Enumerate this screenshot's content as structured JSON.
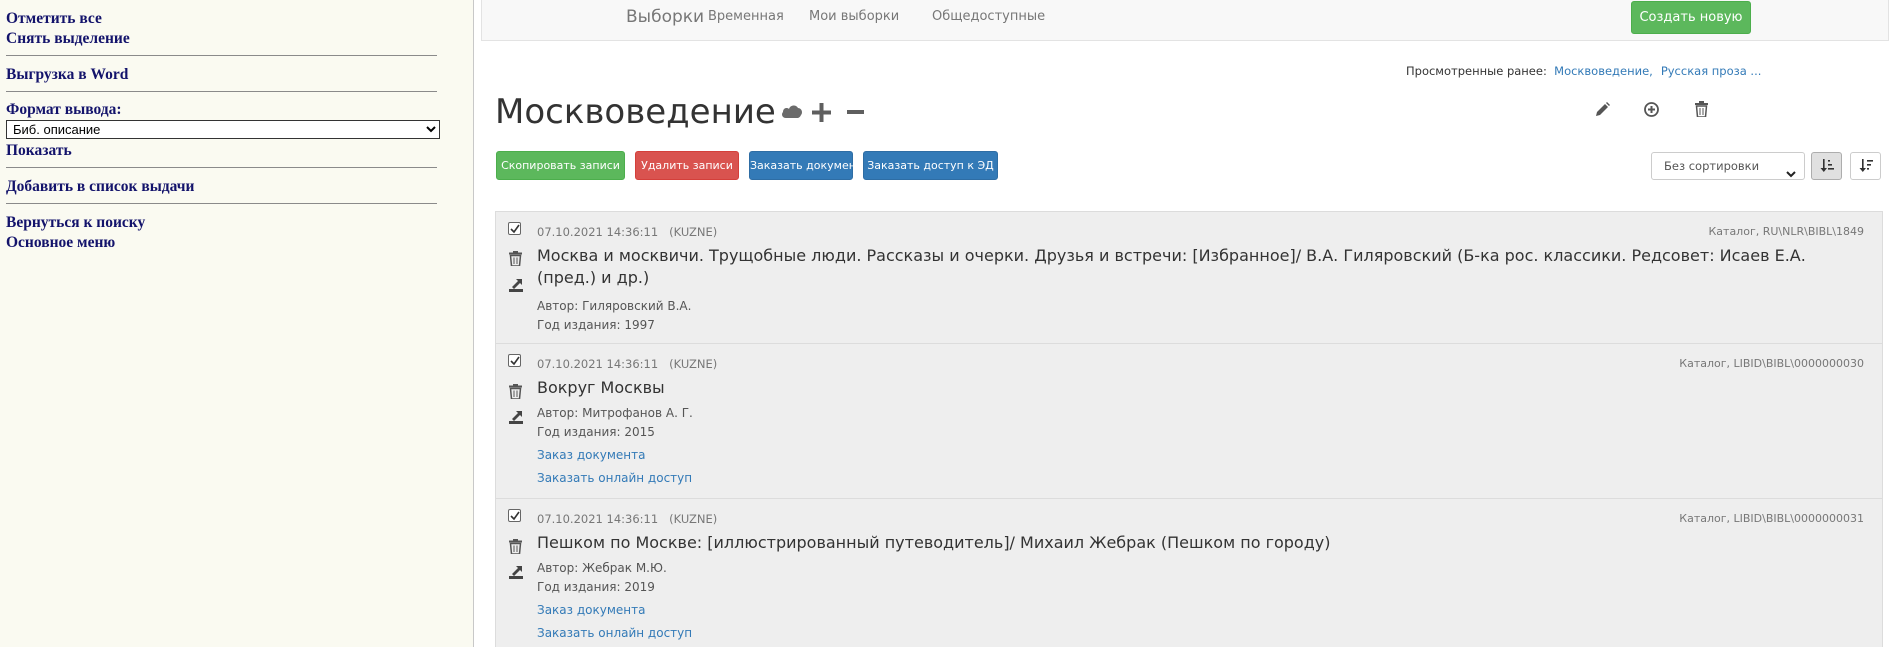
{
  "left": {
    "select_all": "Отметить все",
    "deselect": "Снять выделение",
    "export_word": "Выгрузка в Word",
    "format_label": "Формат вывода:",
    "format_value": "Биб. описание",
    "show": "Показать",
    "add_to_list": "Добавить в список выдачи",
    "back_to_search": "Вернуться к поиску",
    "main_menu": "Основное меню"
  },
  "nav": {
    "brand": "Выборки",
    "items": [
      "Временная",
      "Мои выборки",
      "Общедоступные"
    ],
    "create_button": "Создать новую"
  },
  "recent": {
    "label": "Просмотренные ранее:",
    "links": [
      "Москвоведение",
      "Русская проза ..."
    ]
  },
  "heading": "Москвоведение",
  "buttons": {
    "copy": "Скопировать записи",
    "delete": "Удалить записи",
    "order_docs": "Заказать документы",
    "order_access": "Заказать доступ к ЭД"
  },
  "sort": {
    "value": "Без сортировки"
  },
  "colors": {
    "green": "#5cb85c",
    "red": "#d9534f",
    "blue": "#337ab7",
    "link": "#337ab7",
    "left_text": "#13136b"
  },
  "records": [
    {
      "date": "07.10.2021 14:36:11",
      "user": "(KUZNE)",
      "catalog": "Каталог, RU\\NLR\\BIBL\\1849",
      "title": "Москва и москвичи. Трущобные люди. Рассказы и очерки. Друзья и встречи: [Избранное]/ В.А. Гиляровский (Б-ка рос. классики. Редсовет: Исаев Е.А. (пред.) и др.)",
      "author": "Автор: Гиляровский В.А.",
      "year": "Год издания: 1997"
    },
    {
      "date": "07.10.2021 14:36:11",
      "user": "(KUZNE)",
      "catalog": "Каталог, LIBID\\BIBL\\0000000030",
      "title": "Вокруг Москвы",
      "author": "Автор: Митрофанов А. Г.",
      "year": "Год издания: 2015",
      "order_doc": "Заказ документа",
      "order_online": "Заказать онлайн доступ"
    },
    {
      "date": "07.10.2021 14:36:11",
      "user": "(KUZNE)",
      "catalog": "Каталог, LIBID\\BIBL\\0000000031",
      "title": "Пешком по Москве: [иллюстрированный путеводитель]/ Михаил Жебрак (Пешком по городу)",
      "author": "Автор: Жебрак М.Ю.",
      "year": "Год издания: 2019",
      "order_doc": "Заказ документа",
      "order_online": "Заказать онлайн доступ"
    }
  ]
}
